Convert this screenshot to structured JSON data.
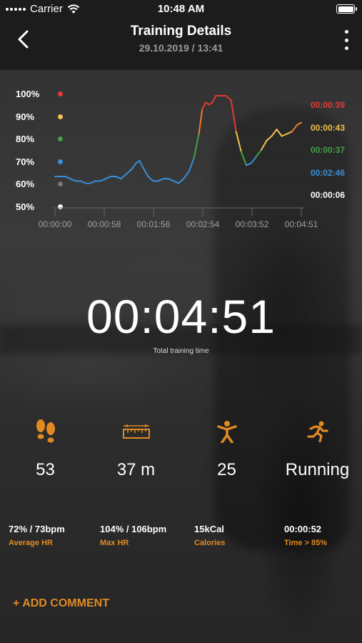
{
  "status_bar": {
    "carrier": "Carrier",
    "time": "10:48 AM"
  },
  "header": {
    "title": "Training Details",
    "subtitle": "29.10.2019 / 13:41"
  },
  "chart_data": {
    "type": "line",
    "yticks": [
      "100%",
      "90%",
      "80%",
      "70%",
      "60%",
      "50%"
    ],
    "ytick_dot_colors": [
      "#e53935",
      "#f2c14e",
      "#43a047",
      "#3a8fd6",
      "#777777",
      "#ffffff"
    ],
    "xticks": [
      "00:00:00",
      "00:00:58",
      "00:01:56",
      "00:02:54",
      "00:03:52",
      "00:04:51"
    ],
    "ylim": [
      50,
      100
    ],
    "x_seconds": [
      0,
      6,
      12,
      18,
      24,
      30,
      36,
      42,
      48,
      54,
      60,
      66,
      72,
      78,
      84,
      90,
      96,
      100,
      104,
      110,
      116,
      122,
      128,
      134,
      140,
      146,
      152,
      158,
      164,
      170,
      174,
      178,
      182,
      186,
      190,
      196,
      202,
      208,
      214,
      220,
      226,
      232,
      238,
      244,
      250,
      256,
      262,
      268,
      274,
      280,
      286,
      291
    ],
    "values": [
      64,
      64,
      64,
      63,
      62,
      62,
      61,
      61,
      62,
      62,
      63,
      64,
      64,
      63,
      65,
      67,
      70,
      71,
      68,
      64,
      62,
      62,
      63,
      63,
      62,
      61,
      63,
      66,
      72,
      83,
      94,
      97,
      96,
      97,
      100,
      100,
      100,
      98,
      84,
      75,
      69,
      70,
      73,
      76,
      80,
      82,
      85,
      82,
      83,
      84,
      87,
      88
    ],
    "zones": [
      {
        "time": "00:00:39",
        "color": "#e53935"
      },
      {
        "time": "00:00:43",
        "color": "#f2c14e"
      },
      {
        "time": "00:00:37",
        "color": "#43a047"
      },
      {
        "time": "00:02:46",
        "color": "#3a8fd6"
      },
      {
        "time": "00:00:06",
        "color": "#ffffff"
      }
    ]
  },
  "training": {
    "total_time": "00:04:51",
    "total_time_label": "Total training time"
  },
  "stats": [
    {
      "icon": "footsteps-icon",
      "value": "53"
    },
    {
      "icon": "ruler-icon",
      "value": "37 m"
    },
    {
      "icon": "jumping-jack-icon",
      "value": "25"
    },
    {
      "icon": "running-person-icon",
      "value": "Running"
    }
  ],
  "metrics": [
    {
      "value": "72% / 73bpm",
      "label": "Average HR"
    },
    {
      "value": "104% / 106bpm",
      "label": "Max HR"
    },
    {
      "value": "15kCal",
      "label": "Calories"
    },
    {
      "value": "00:00:52",
      "label": "Time > 85%"
    }
  ],
  "actions": {
    "add_comment": "+ ADD COMMENT"
  },
  "colors": {
    "accent": "#e08a22",
    "header_bg": "#1c1c1c"
  }
}
